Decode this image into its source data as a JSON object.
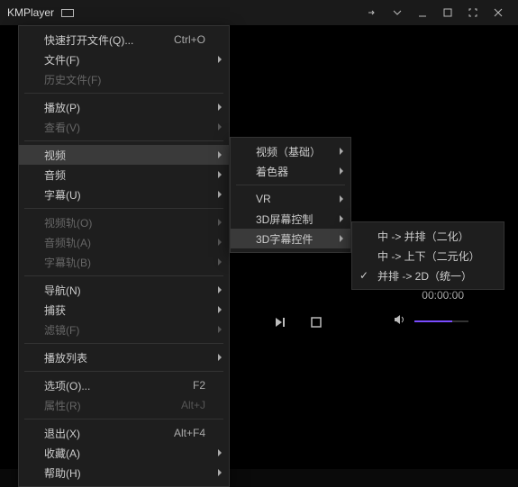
{
  "window": {
    "title": "KMPlayer"
  },
  "transport": {
    "timecode": "00:00:00"
  },
  "menu_main": [
    {
      "type": "item",
      "label": "快速打开文件(Q)...",
      "shortcut": "Ctrl+O"
    },
    {
      "type": "item",
      "label": "文件(F)",
      "submenu": true
    },
    {
      "type": "item",
      "label": "历史文件(F)",
      "disabled": true
    },
    {
      "type": "sep"
    },
    {
      "type": "item",
      "label": "播放(P)",
      "submenu": true
    },
    {
      "type": "item",
      "label": "查看(V)",
      "disabled": true,
      "submenu": true
    },
    {
      "type": "sep"
    },
    {
      "type": "item",
      "label": "视频",
      "submenu": true,
      "highlight": true
    },
    {
      "type": "item",
      "label": "音频",
      "submenu": true
    },
    {
      "type": "item",
      "label": "字幕(U)",
      "submenu": true
    },
    {
      "type": "sep"
    },
    {
      "type": "item",
      "label": "视频轨(O)",
      "disabled": true,
      "submenu": true
    },
    {
      "type": "item",
      "label": "音频轨(A)",
      "disabled": true,
      "submenu": true
    },
    {
      "type": "item",
      "label": "字幕轨(B)",
      "disabled": true,
      "submenu": true
    },
    {
      "type": "sep"
    },
    {
      "type": "item",
      "label": "导航(N)",
      "submenu": true
    },
    {
      "type": "item",
      "label": "捕获",
      "submenu": true
    },
    {
      "type": "item",
      "label": "滤镜(F)",
      "disabled": true,
      "submenu": true
    },
    {
      "type": "sep"
    },
    {
      "type": "item",
      "label": "播放列表",
      "submenu": true
    },
    {
      "type": "sep"
    },
    {
      "type": "item",
      "label": "选项(O)...",
      "shortcut": "F2"
    },
    {
      "type": "item",
      "label": "属性(R)",
      "shortcut": "Alt+J",
      "disabled": true
    },
    {
      "type": "sep"
    },
    {
      "type": "item",
      "label": "退出(X)",
      "shortcut": "Alt+F4"
    },
    {
      "type": "item",
      "label": "收藏(A)",
      "submenu": true
    },
    {
      "type": "item",
      "label": "帮助(H)",
      "submenu": true
    }
  ],
  "menu_sub1": [
    {
      "type": "item",
      "label": "视频（基础）",
      "submenu": true
    },
    {
      "type": "item",
      "label": "着色器",
      "submenu": true
    },
    {
      "type": "sep"
    },
    {
      "type": "item",
      "label": "VR",
      "submenu": true
    },
    {
      "type": "item",
      "label": "3D屏幕控制",
      "submenu": true
    },
    {
      "type": "item",
      "label": "3D字幕控件",
      "submenu": true,
      "highlight": true
    }
  ],
  "menu_sub2": [
    {
      "type": "item",
      "label": "中 -> 并排（二化）"
    },
    {
      "type": "item",
      "label": "中 -> 上下（二元化）"
    },
    {
      "type": "item",
      "label": "并排 -> 2D（统一）",
      "checked": true
    }
  ]
}
